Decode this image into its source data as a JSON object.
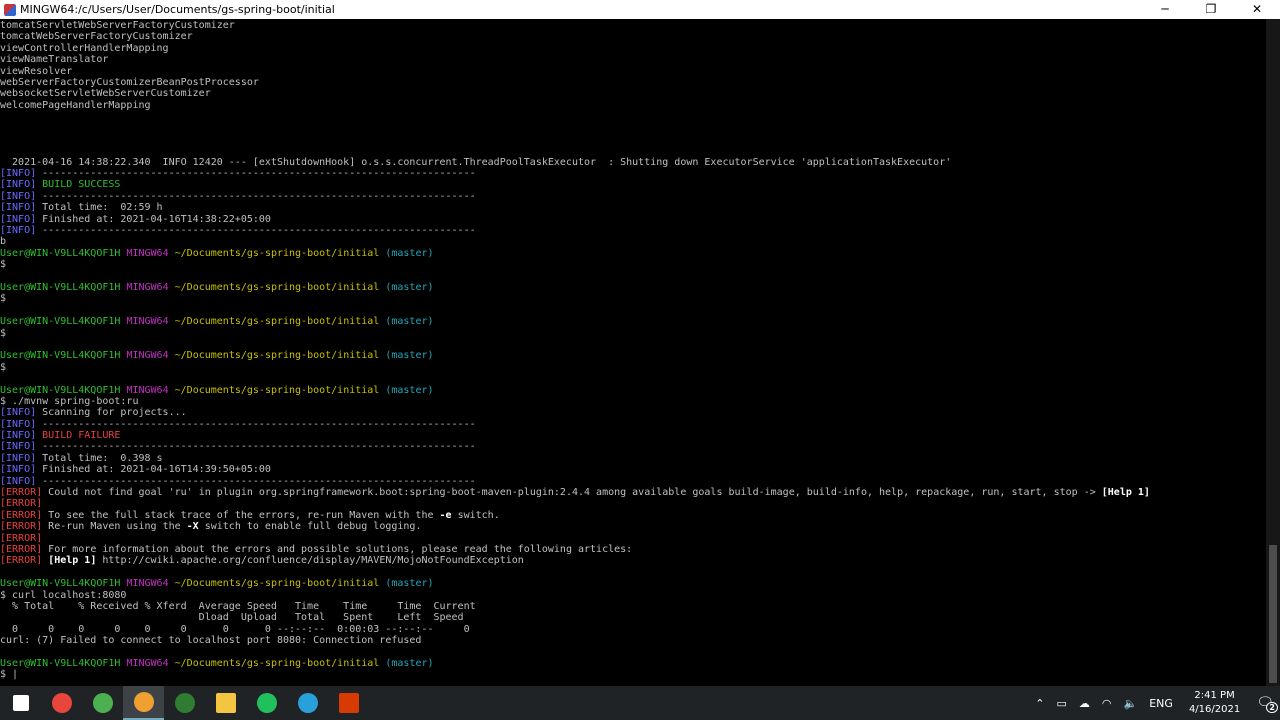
{
  "window": {
    "title": "MINGW64:/c/Users/User/Documents/gs-spring-boot/initial",
    "minimize": "─",
    "maximize": "❐",
    "close": "✕"
  },
  "terminal": {
    "lines": [
      [
        {
          "t": "tomcatServletWebServerFactoryCustomizer",
          "c": "def"
        }
      ],
      [
        {
          "t": "tomcatWebServerFactoryCustomizer",
          "c": "def"
        }
      ],
      [
        {
          "t": "viewControllerHandlerMapping",
          "c": "def"
        }
      ],
      [
        {
          "t": "viewNameTranslator",
          "c": "def"
        }
      ],
      [
        {
          "t": "viewResolver",
          "c": "def"
        }
      ],
      [
        {
          "t": "webServerFactoryCustomizerBeanPostProcessor",
          "c": "def"
        }
      ],
      [
        {
          "t": "websocketServletWebServerCustomizer",
          "c": "def"
        }
      ],
      [
        {
          "t": "welcomePageHandlerMapping",
          "c": "def"
        }
      ],
      [],
      [],
      [],
      [],
      [
        {
          "t": "  2021-04-16 14:38:22.340  INFO 12420 --- [extShutdownHook] o.s.s.concurrent.ThreadPoolTaskExecutor  : Shutting down ExecutorService 'applicationTaskExecutor'",
          "c": "def"
        }
      ],
      [
        {
          "t": "[INFO]",
          "c": "blue"
        },
        {
          "t": " ------------------------------------------------------------------------",
          "c": "def"
        }
      ],
      [
        {
          "t": "[INFO]",
          "c": "blue"
        },
        {
          "t": " ",
          "c": "def"
        },
        {
          "t": "BUILD SUCCESS",
          "c": "green"
        }
      ],
      [
        {
          "t": "[INFO]",
          "c": "blue"
        },
        {
          "t": " ------------------------------------------------------------------------",
          "c": "def"
        }
      ],
      [
        {
          "t": "[INFO]",
          "c": "blue"
        },
        {
          "t": " Total time:  02:59 h",
          "c": "def"
        }
      ],
      [
        {
          "t": "[INFO]",
          "c": "blue"
        },
        {
          "t": " Finished at: 2021-04-16T14:38:22+05:00",
          "c": "def"
        }
      ],
      [
        {
          "t": "[INFO]",
          "c": "blue"
        },
        {
          "t": " ------------------------------------------------------------------------",
          "c": "def"
        }
      ],
      [
        {
          "t": "b",
          "c": "def"
        }
      ],
      [
        {
          "t": "User@WIN-V9LL4KQOF1H",
          "c": "green"
        },
        {
          "t": " ",
          "c": "def"
        },
        {
          "t": "MINGW64",
          "c": "mag"
        },
        {
          "t": " ~/Documents/gs-spring-boot/initial",
          "c": "yel"
        },
        {
          "t": " (master)",
          "c": "cyan"
        }
      ],
      [
        {
          "t": "$",
          "c": "def"
        }
      ],
      [],
      [
        {
          "t": "User@WIN-V9LL4KQOF1H",
          "c": "green"
        },
        {
          "t": " ",
          "c": "def"
        },
        {
          "t": "MINGW64",
          "c": "mag"
        },
        {
          "t": " ~/Documents/gs-spring-boot/initial",
          "c": "yel"
        },
        {
          "t": " (master)",
          "c": "cyan"
        }
      ],
      [
        {
          "t": "$",
          "c": "def"
        }
      ],
      [],
      [
        {
          "t": "User@WIN-V9LL4KQOF1H",
          "c": "green"
        },
        {
          "t": " ",
          "c": "def"
        },
        {
          "t": "MINGW64",
          "c": "mag"
        },
        {
          "t": " ~/Documents/gs-spring-boot/initial",
          "c": "yel"
        },
        {
          "t": " (master)",
          "c": "cyan"
        }
      ],
      [
        {
          "t": "$",
          "c": "def"
        }
      ],
      [],
      [
        {
          "t": "User@WIN-V9LL4KQOF1H",
          "c": "green"
        },
        {
          "t": " ",
          "c": "def"
        },
        {
          "t": "MINGW64",
          "c": "mag"
        },
        {
          "t": " ~/Documents/gs-spring-boot/initial",
          "c": "yel"
        },
        {
          "t": " (master)",
          "c": "cyan"
        }
      ],
      [
        {
          "t": "$",
          "c": "def"
        }
      ],
      [],
      [
        {
          "t": "User@WIN-V9LL4KQOF1H",
          "c": "green"
        },
        {
          "t": " ",
          "c": "def"
        },
        {
          "t": "MINGW64",
          "c": "mag"
        },
        {
          "t": " ~/Documents/gs-spring-boot/initial",
          "c": "yel"
        },
        {
          "t": " (master)",
          "c": "cyan"
        }
      ],
      [
        {
          "t": "$ ./mvnw spring-boot:ru",
          "c": "def"
        }
      ],
      [
        {
          "t": "[INFO]",
          "c": "blue"
        },
        {
          "t": " Scanning for projects...",
          "c": "def"
        }
      ],
      [
        {
          "t": "[INFO]",
          "c": "blue"
        },
        {
          "t": " ------------------------------------------------------------------------",
          "c": "def"
        }
      ],
      [
        {
          "t": "[INFO]",
          "c": "blue"
        },
        {
          "t": " ",
          "c": "def"
        },
        {
          "t": "BUILD FAILURE",
          "c": "red"
        }
      ],
      [
        {
          "t": "[INFO]",
          "c": "blue"
        },
        {
          "t": " ------------------------------------------------------------------------",
          "c": "def"
        }
      ],
      [
        {
          "t": "[INFO]",
          "c": "blue"
        },
        {
          "t": " Total time:  0.398 s",
          "c": "def"
        }
      ],
      [
        {
          "t": "[INFO]",
          "c": "blue"
        },
        {
          "t": " Finished at: 2021-04-16T14:39:50+05:00",
          "c": "def"
        }
      ],
      [
        {
          "t": "[INFO]",
          "c": "blue"
        },
        {
          "t": " ------------------------------------------------------------------------",
          "c": "def"
        }
      ],
      [
        {
          "t": "[ERROR]",
          "c": "red"
        },
        {
          "t": " Could not find goal 'ru' in plugin org.springframework.boot:spring-boot-maven-plugin:2.4.4 among available goals build-image, build-info, help, repackage, run, start, stop -> ",
          "c": "def"
        },
        {
          "t": "[Help 1]",
          "c": "bold"
        }
      ],
      [
        {
          "t": "[ERROR]",
          "c": "red"
        }
      ],
      [
        {
          "t": "[ERROR]",
          "c": "red"
        },
        {
          "t": " To see the full stack trace of the errors, re-run Maven with the ",
          "c": "def"
        },
        {
          "t": "-e",
          "c": "bold"
        },
        {
          "t": " switch.",
          "c": "def"
        }
      ],
      [
        {
          "t": "[ERROR]",
          "c": "red"
        },
        {
          "t": " Re-run Maven using the ",
          "c": "def"
        },
        {
          "t": "-X",
          "c": "bold"
        },
        {
          "t": " switch to enable full debug logging.",
          "c": "def"
        }
      ],
      [
        {
          "t": "[ERROR]",
          "c": "red"
        }
      ],
      [
        {
          "t": "[ERROR]",
          "c": "red"
        },
        {
          "t": " For more information about the errors and possible solutions, please read the following articles:",
          "c": "def"
        }
      ],
      [
        {
          "t": "[ERROR]",
          "c": "red"
        },
        {
          "t": " ",
          "c": "def"
        },
        {
          "t": "[Help 1]",
          "c": "bold"
        },
        {
          "t": " http://cwiki.apache.org/confluence/display/MAVEN/MojoNotFoundException",
          "c": "def"
        }
      ],
      [],
      [
        {
          "t": "User@WIN-V9LL4KQOF1H",
          "c": "green"
        },
        {
          "t": " ",
          "c": "def"
        },
        {
          "t": "MINGW64",
          "c": "mag"
        },
        {
          "t": " ~/Documents/gs-spring-boot/initial",
          "c": "yel"
        },
        {
          "t": " (master)",
          "c": "cyan"
        }
      ],
      [
        {
          "t": "$ curl localhost:8080",
          "c": "def"
        }
      ],
      [
        {
          "t": "  % Total    % Received % Xferd  Average Speed   Time    Time     Time  Current",
          "c": "def"
        }
      ],
      [
        {
          "t": "                                 Dload  Upload   Total   Spent    Left  Speed",
          "c": "def"
        }
      ],
      [
        {
          "t": "  0     0    0     0    0     0      0      0 --:--:--  0:00:03 --:--:--     0",
          "c": "def"
        }
      ],
      [
        {
          "t": "curl: (7) Failed to connect to localhost port 8080: Connection refused",
          "c": "def"
        }
      ],
      [],
      [
        {
          "t": "User@WIN-V9LL4KQOF1H",
          "c": "green"
        },
        {
          "t": " ",
          "c": "def"
        },
        {
          "t": "MINGW64",
          "c": "mag"
        },
        {
          "t": " ~/Documents/gs-spring-boot/initial",
          "c": "yel"
        },
        {
          "t": " (master)",
          "c": "cyan"
        }
      ],
      [
        {
          "t": "$ |",
          "c": "def"
        }
      ]
    ]
  },
  "taskbar": {
    "apps": [
      {
        "name": "start",
        "color": "#ffffff"
      },
      {
        "name": "chrome",
        "color": "#e8453c"
      },
      {
        "name": "green-app",
        "color": "#4caf50"
      },
      {
        "name": "git-bash",
        "color": "#f0a030"
      },
      {
        "name": "f-app",
        "color": "#2e7d32"
      },
      {
        "name": "file-explorer",
        "color": "#f4c542"
      },
      {
        "name": "evernote",
        "color": "#20c05c"
      },
      {
        "name": "telegram",
        "color": "#2aa0da"
      },
      {
        "name": "office",
        "color": "#d83b01"
      }
    ],
    "tray": {
      "lang": "ENG",
      "time": "2:41 PM",
      "date": "4/16/2021",
      "notifications": "2"
    }
  }
}
